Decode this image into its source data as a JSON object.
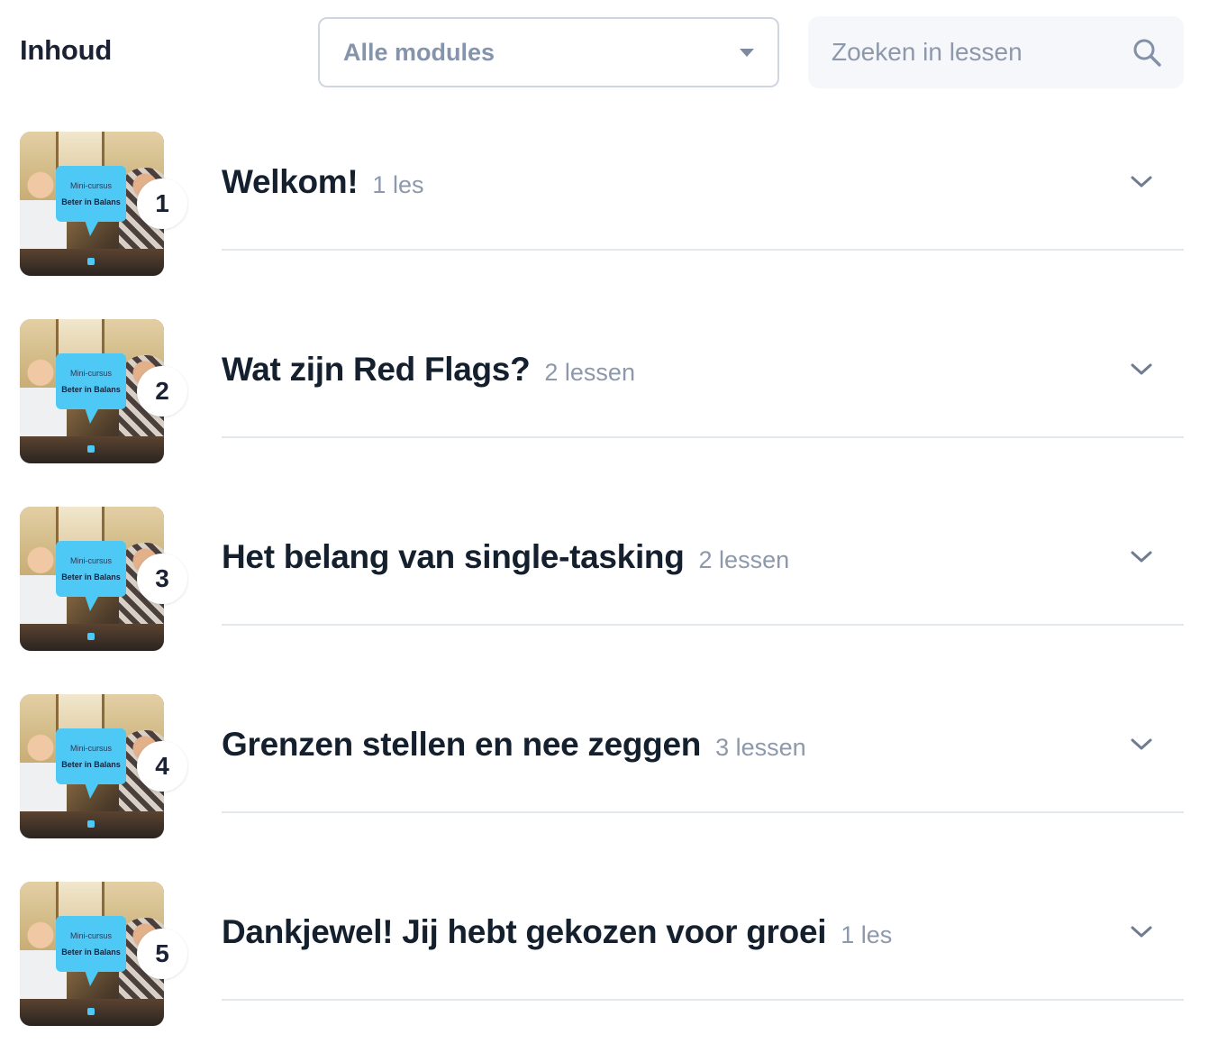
{
  "header": {
    "title": "Inhoud",
    "module_filter": {
      "selected": "Alle modules"
    },
    "search": {
      "placeholder": "Zoeken in lessen",
      "value": ""
    }
  },
  "thumbnail": {
    "line1": "Mini-cursus",
    "line2": "Beter in Balans"
  },
  "modules": [
    {
      "number": "1",
      "title": "Welkom!",
      "count": "1 les"
    },
    {
      "number": "2",
      "title": "Wat zijn Red Flags?",
      "count": "2 lessen"
    },
    {
      "number": "3",
      "title": "Het belang van single-tasking",
      "count": "2 lessen"
    },
    {
      "number": "4",
      "title": "Grenzen stellen en nee zeggen",
      "count": "3 lessen"
    },
    {
      "number": "5",
      "title": "Dankjewel! Jij hebt gekozen voor groei",
      "count": "1 les"
    }
  ],
  "colors": {
    "text_dark": "#15202f",
    "muted": "#8d98ab",
    "accent_bubble": "#4ec9f5",
    "divider": "#e3e7ee"
  }
}
